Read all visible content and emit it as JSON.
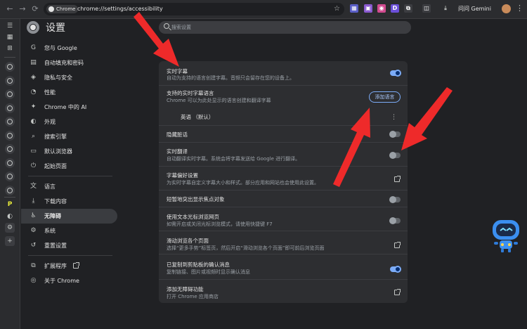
{
  "toolbar": {
    "back_icon": "←",
    "forward_icon": "→",
    "reload_icon": "⟳",
    "chip_label": "Chrome",
    "url": "chrome://settings/accessibility",
    "star_icon": "☆",
    "extensions": [
      {
        "label": "▦",
        "color": "#5b5fc7"
      },
      {
        "label": "▣",
        "color": "#8a5ad0"
      },
      {
        "label": "◉",
        "color": "#d14b8f"
      },
      {
        "label": "D",
        "color": "#6b4fd8"
      },
      {
        "label": "⧉",
        "color": "#3c3d41"
      }
    ],
    "gemini_label": "问问 Gemini",
    "menu_icon": "⋮"
  },
  "settings": {
    "title": "设置",
    "search_placeholder": "搜索设置"
  },
  "nav": [
    {
      "label": "您与 Google",
      "icon": "G"
    },
    {
      "label": "自动填充和密码",
      "icon": "▤"
    },
    {
      "label": "隐私与安全",
      "icon": "◈"
    },
    {
      "label": "性能",
      "icon": "◔"
    },
    {
      "label": "Chrome 中的 AI",
      "icon": "✦"
    },
    {
      "label": "外观",
      "icon": "◐"
    },
    {
      "label": "搜索引擎",
      "icon": "⌕"
    },
    {
      "label": "默认浏览器",
      "icon": "▭"
    },
    {
      "label": "起始页面",
      "icon": "⏻"
    },
    {
      "label": "语言",
      "icon": "文"
    },
    {
      "label": "下载内容",
      "icon": "⤓"
    },
    {
      "label": "无障碍",
      "icon": "♿"
    },
    {
      "label": "系统",
      "icon": "⚙"
    },
    {
      "label": "重置设置",
      "icon": "↺"
    },
    {
      "label": "扩展程序",
      "icon": "⧉"
    },
    {
      "label": "关于 Chrome",
      "icon": "◎"
    }
  ],
  "nav_active_index": 11,
  "accessibility": {
    "live_caption": {
      "title": "实时字幕",
      "sub": "自动为支持的语言创建字幕。音频只会留存在您的设备上。",
      "on": true
    },
    "languages": {
      "title": "支持的实时字幕语言",
      "sub": "Chrome 可以为此处显示的语言创建和翻译字幕",
      "button": "添加语言"
    },
    "english": {
      "label": "英语 （默认）",
      "more_icon": "⋮"
    },
    "hide_profanity": {
      "title": "隐藏脏话",
      "on": false
    },
    "live_translate": {
      "title": "实时翻译",
      "sub": "自动翻译实时字幕。系统会将字幕发送给 Google 进行翻译。",
      "on": false
    },
    "caption_prefs": {
      "title": "字幕偏好设置",
      "sub": "为实时字幕自定义字幕大小和样式。部分应用和网站也会使用此设置。"
    },
    "highlight_focus": {
      "title": "短暂地突出显示焦点对象",
      "on": false
    },
    "text_cursor": {
      "title": "使用文本光标浏览网页",
      "sub": "如需开启或关闭光标浏览模式，请使用快捷键 F7",
      "on": false
    },
    "swipe_nav": {
      "title": "滑动浏览各个页面",
      "sub": "选择“更多手势”标签页，然后开启“滑动浏览各个页面”即可前后浏览页面"
    },
    "copy_confirm": {
      "title": "已复制到剪贴板的确认消息",
      "sub": "复制链接、图片或视频时显示确认消息",
      "on": true
    },
    "add_features": {
      "title": "添加无障碍功能",
      "sub": "打开 Chrome 应用商店"
    }
  },
  "rail": {
    "top_icons": [
      "☰",
      "▦",
      "⊞"
    ],
    "tab_count": 10,
    "bottom_icons": [
      "P",
      "◐",
      "⚙",
      "+"
    ]
  },
  "colors": {
    "accent": "#7cacf8",
    "arrow": "#ee2a2a",
    "card": "#2d2e31",
    "background": "#202124"
  }
}
